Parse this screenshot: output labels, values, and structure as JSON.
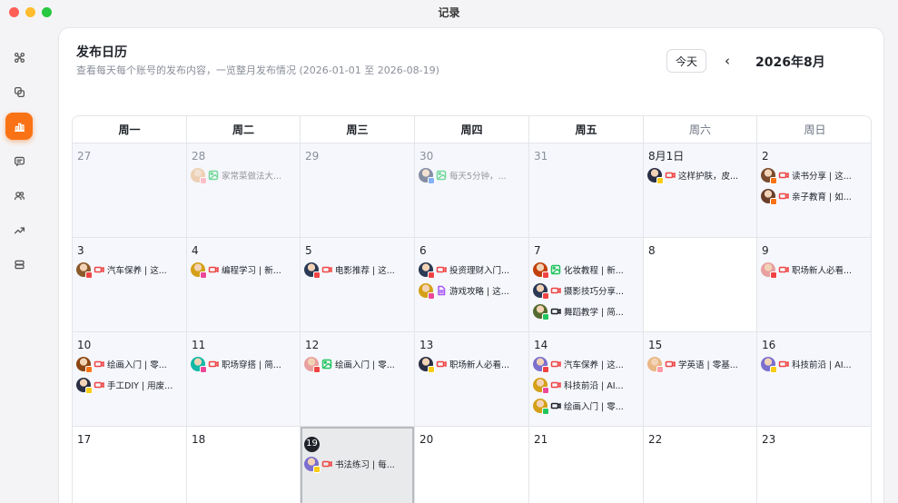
{
  "window": {
    "title": "记录"
  },
  "sidebar": {
    "items": [
      {
        "icon": "command-icon",
        "active": false
      },
      {
        "icon": "layers-icon",
        "active": false
      },
      {
        "icon": "bar-chart-icon",
        "active": true
      },
      {
        "icon": "message-list-icon",
        "active": false
      },
      {
        "icon": "users-icon",
        "active": false
      },
      {
        "icon": "trend-icon",
        "active": false
      },
      {
        "icon": "database-icon",
        "active": false
      }
    ]
  },
  "header": {
    "title": "发布日历",
    "subtitle": "查看每天每个账号的发布内容，一览整月发布情况 (2026-01-01 至 2026-08-19)",
    "today_label": "今天",
    "prev_label": "‹",
    "month_label": "2026年8月"
  },
  "calendar": {
    "weekdays": [
      "周一",
      "周二",
      "周三",
      "周四",
      "周五",
      "周六",
      "周日"
    ],
    "days": [
      {
        "label": "27",
        "muted": true,
        "bg": "blue",
        "posts": []
      },
      {
        "label": "28",
        "muted": true,
        "bg": "blue",
        "posts": [
          {
            "avatar": "#e8b784",
            "badge": "#ff9aa8",
            "type": "image",
            "text": "家常菜做法大...",
            "faded": true
          }
        ]
      },
      {
        "label": "29",
        "muted": true,
        "bg": "blue",
        "posts": []
      },
      {
        "label": "30",
        "muted": true,
        "bg": "blue",
        "posts": [
          {
            "avatar": "#3b4a6b",
            "badge": "#3b82f6",
            "type": "image",
            "text": "每天5分钟，...",
            "faded": true
          }
        ]
      },
      {
        "label": "31",
        "muted": true,
        "bg": "blue",
        "posts": []
      },
      {
        "label": "8月1日",
        "muted": false,
        "bg": "blue",
        "posts": [
          {
            "avatar": "#2b2f45",
            "badge": "#facc15",
            "type": "video",
            "text": "这样护肤，皮..."
          }
        ]
      },
      {
        "label": "2",
        "muted": false,
        "bg": "blue",
        "posts": [
          {
            "avatar": "#7a4b2e",
            "badge": "#f97316",
            "type": "video",
            "text": "读书分享 | 这..."
          },
          {
            "avatar": "#6b3f2a",
            "badge": "#f97316",
            "type": "video",
            "text": "亲子教育 | 如..."
          }
        ]
      },
      {
        "label": "3",
        "muted": false,
        "bg": "blue",
        "posts": [
          {
            "avatar": "#8b5a2b",
            "badge": "#ef4444",
            "type": "video",
            "text": "汽车保养 | 这..."
          }
        ]
      },
      {
        "label": "4",
        "muted": false,
        "bg": "blue",
        "posts": [
          {
            "avatar": "#d4a017",
            "badge": "#ec4899",
            "type": "video",
            "text": "编程学习 | 新..."
          }
        ]
      },
      {
        "label": "5",
        "muted": false,
        "bg": "blue",
        "posts": [
          {
            "avatar": "#2b3a55",
            "badge": "#ef4444",
            "type": "video",
            "text": "电影推荐 | 这..."
          }
        ]
      },
      {
        "label": "6",
        "muted": false,
        "bg": "blue",
        "posts": [
          {
            "avatar": "#2b3a55",
            "badge": "#ef4444",
            "type": "video",
            "text": "投资理财入门..."
          },
          {
            "avatar": "#d4a017",
            "badge": "#ec4899",
            "type": "doc",
            "text": "游戏攻略 | 这..."
          }
        ]
      },
      {
        "label": "7",
        "muted": false,
        "bg": "blue",
        "posts": [
          {
            "avatar": "#c2410c",
            "badge": "#ef4444",
            "type": "image",
            "text": "化妆教程 | 新..."
          },
          {
            "avatar": "#2b3a55",
            "badge": "#ef4444",
            "type": "video",
            "text": "摄影技巧分享..."
          },
          {
            "avatar": "#556b2f",
            "badge": "#22c55e",
            "type": "video-dark",
            "text": "舞蹈教学 | 简..."
          }
        ]
      },
      {
        "label": "8",
        "muted": false,
        "bg": "white",
        "posts": []
      },
      {
        "label": "9",
        "muted": false,
        "bg": "blue",
        "posts": [
          {
            "avatar": "#e8a0a0",
            "badge": "#ef4444",
            "type": "video",
            "text": "职场新人必看..."
          }
        ]
      },
      {
        "label": "10",
        "muted": false,
        "bg": "blue",
        "posts": [
          {
            "avatar": "#8b4513",
            "badge": "#f97316",
            "type": "video",
            "text": "绘画入门 | 零..."
          },
          {
            "avatar": "#2b2f45",
            "badge": "#facc15",
            "type": "video",
            "text": "手工DIY | 用废..."
          }
        ]
      },
      {
        "label": "11",
        "muted": false,
        "bg": "blue",
        "posts": [
          {
            "avatar": "#14b8a6",
            "badge": "#ec4899",
            "type": "video",
            "text": "职场穿搭 | 简..."
          }
        ]
      },
      {
        "label": "12",
        "muted": false,
        "bg": "blue",
        "posts": [
          {
            "avatar": "#e8a0a0",
            "badge": "#ef4444",
            "type": "image",
            "text": "绘画入门 | 零..."
          }
        ]
      },
      {
        "label": "13",
        "muted": false,
        "bg": "blue",
        "posts": [
          {
            "avatar": "#2b2f45",
            "badge": "#facc15",
            "type": "video",
            "text": "职场新人必看..."
          }
        ]
      },
      {
        "label": "14",
        "muted": false,
        "bg": "blue",
        "posts": [
          {
            "avatar": "#7c6fcd",
            "badge": "#ef4444",
            "type": "video",
            "text": "汽车保养 | 这..."
          },
          {
            "avatar": "#d4a017",
            "badge": "#ec4899",
            "type": "video",
            "text": "科技前沿 | AI..."
          },
          {
            "avatar": "#d4a017",
            "badge": "#22c55e",
            "type": "video-dark",
            "text": "绘画入门 | 零..."
          }
        ]
      },
      {
        "label": "15",
        "muted": false,
        "bg": "blue",
        "posts": [
          {
            "avatar": "#e8b784",
            "badge": "#ff9aa8",
            "type": "video",
            "text": "学英语 | 零基..."
          }
        ]
      },
      {
        "label": "16",
        "muted": false,
        "bg": "blue",
        "posts": [
          {
            "avatar": "#7c6fcd",
            "badge": "#facc15",
            "type": "video",
            "text": "科技前沿 | AI..."
          }
        ]
      },
      {
        "label": "17",
        "muted": false,
        "bg": "white",
        "posts": []
      },
      {
        "label": "18",
        "muted": false,
        "bg": "white",
        "posts": []
      },
      {
        "label": "19",
        "muted": false,
        "bg": "today",
        "today": true,
        "posts": [
          {
            "avatar": "#7c6fcd",
            "badge": "#facc15",
            "type": "video",
            "text": "书法练习 | 每..."
          }
        ]
      },
      {
        "label": "20",
        "muted": false,
        "bg": "white",
        "posts": []
      },
      {
        "label": "21",
        "muted": false,
        "bg": "white",
        "posts": []
      },
      {
        "label": "22",
        "muted": false,
        "bg": "white",
        "posts": []
      },
      {
        "label": "23",
        "muted": false,
        "bg": "white",
        "posts": []
      }
    ]
  },
  "colors": {
    "accent": "#f97316",
    "video_icon": "#ef4444",
    "image_icon": "#22c55e",
    "doc_icon": "#a855f7",
    "video_dark_icon": "#1f2329"
  }
}
